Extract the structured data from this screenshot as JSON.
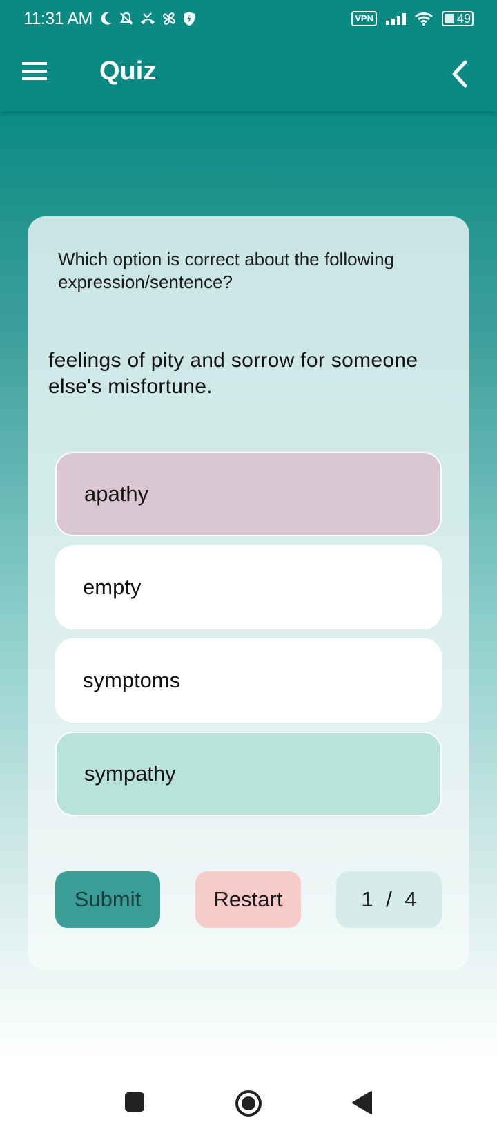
{
  "status_bar": {
    "time": "11:31 AM",
    "vpn": "VPN",
    "battery": "49"
  },
  "app_bar": {
    "title": "Quiz"
  },
  "quiz": {
    "prompt": "Which option is correct about the following expression/sentence?",
    "question": "feelings of pity and sorrow for someone else's misfortune.",
    "options": [
      {
        "label": "apathy",
        "state": "selected-wrong"
      },
      {
        "label": "empty",
        "state": "normal"
      },
      {
        "label": "symptoms",
        "state": "normal"
      },
      {
        "label": "sympathy",
        "state": "correct"
      }
    ],
    "submit_label": "Submit",
    "restart_label": "Restart",
    "counter": "1 / 4"
  },
  "colors": {
    "primary": "#0b8a84",
    "wrong_option": "#d9c6d0",
    "correct_option": "#b8e3da",
    "submit_bg": "#3a9d98",
    "restart_bg": "#f7cbc8"
  }
}
